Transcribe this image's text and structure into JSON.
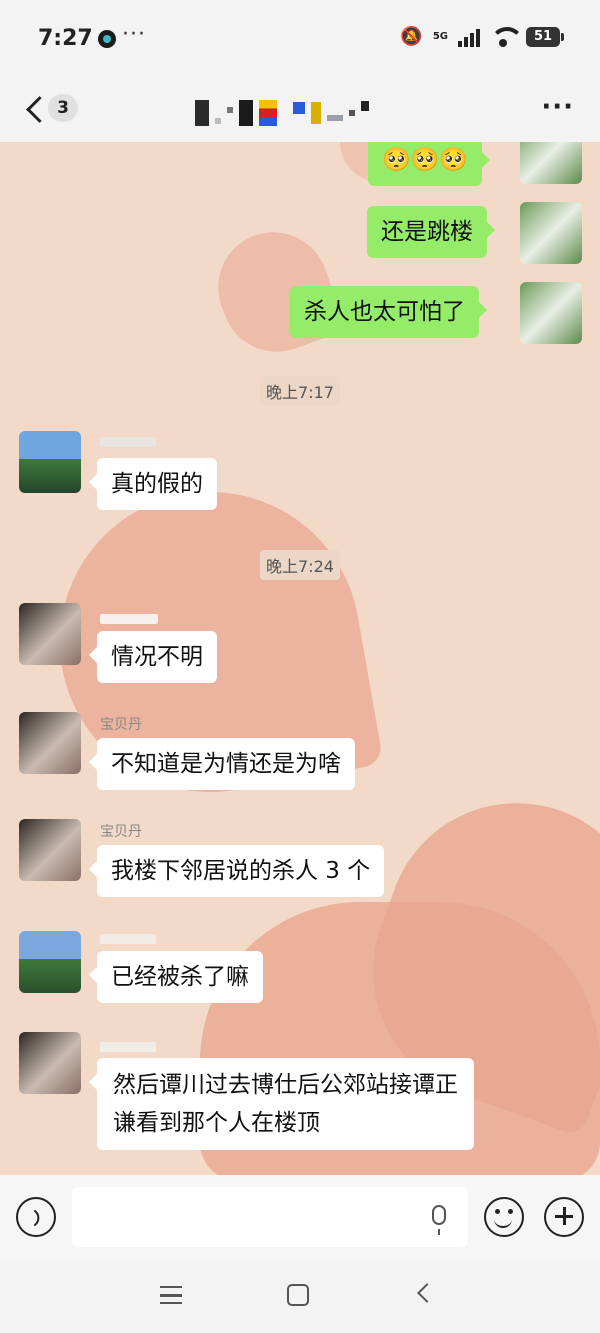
{
  "status_bar": {
    "time": "7:27",
    "dots": "···",
    "network": "5G",
    "battery": "51"
  },
  "nav": {
    "unread_count": "3",
    "more": "···"
  },
  "messages": {
    "sent_1": "🥺🥺🥺",
    "sent_2": "还是跳楼",
    "sent_3": "杀人也太可怕了",
    "time_1": "晚上7:17",
    "recv_1": "真的假的",
    "time_2": "晚上7:24",
    "recv_2": "情况不明",
    "sender_3": "宝贝丹",
    "recv_3": "不知道是为情还是为啥",
    "sender_4": "宝贝丹",
    "recv_4": "我楼下邻居说的杀人 3 个",
    "recv_5": "已经被杀了嘛",
    "recv_6_line1": "然后谭川过去博仕后公郊站接谭正",
    "recv_6_line2": "谦看到那个人在楼顶"
  },
  "colors": {
    "incoming_bubble": "#ffffff",
    "outgoing_bubble": "#95ec69",
    "chat_background": "#f3dac8",
    "heart": "#e9a690"
  }
}
